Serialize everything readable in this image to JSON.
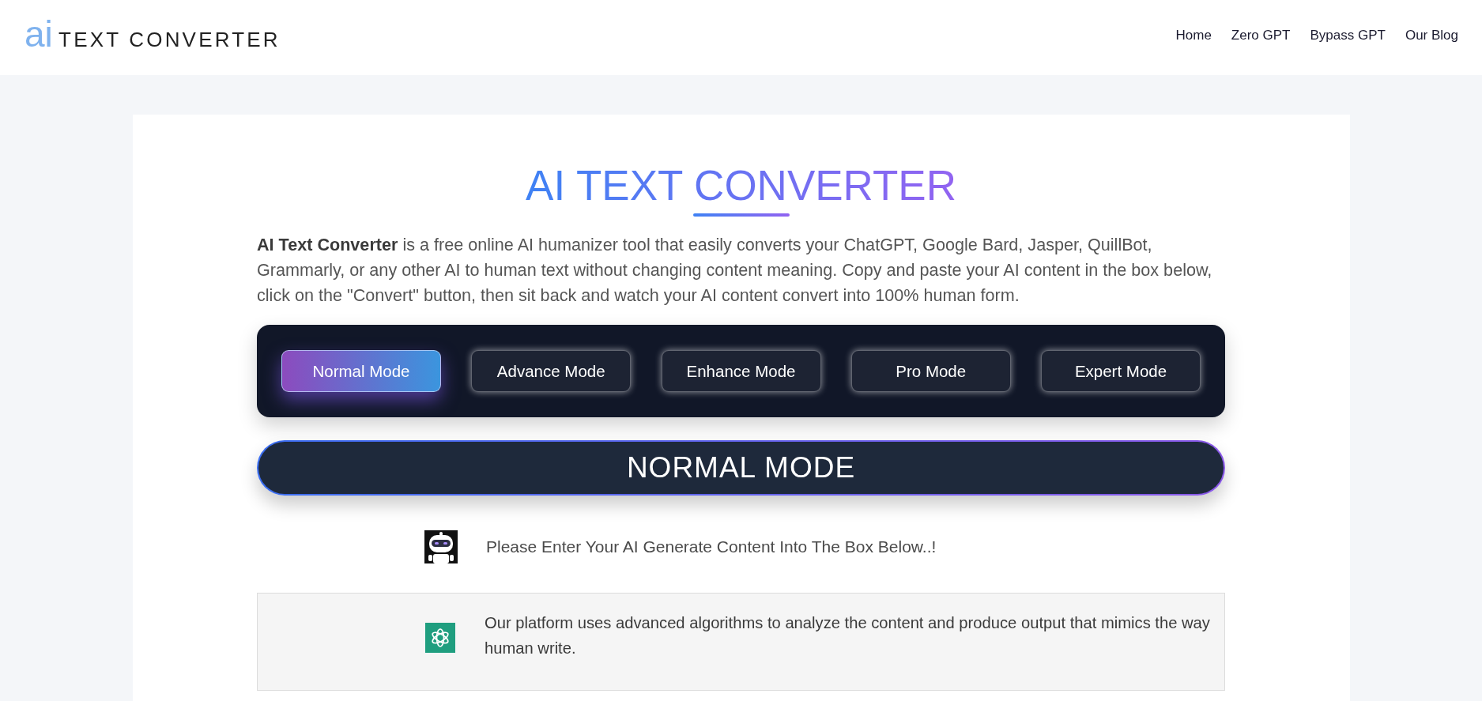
{
  "header": {
    "logo": {
      "mark": "ai",
      "text": "TEXT CONVERTER"
    },
    "nav": [
      {
        "label": "Home"
      },
      {
        "label": "Zero GPT"
      },
      {
        "label": "Bypass GPT"
      },
      {
        "label": "Our Blog"
      }
    ]
  },
  "hero": {
    "title": "AI TEXT CONVERTER",
    "intro": "**AI Text Converter** is a free online AI humanizer tool that easily converts your ChatGPT, Google Bard, Jasper, QuillBot, Grammarly, or any other AI to human text without changing content meaning. Copy and paste your AI content in the box below, click on the \"Convert\" button, then sit back and watch your AI content convert into 100% human form."
  },
  "modes": [
    {
      "label": "Normal Mode",
      "selected": true
    },
    {
      "label": "Advance Mode",
      "selected": false
    },
    {
      "label": "Enhance Mode",
      "selected": false
    },
    {
      "label": "Pro Mode",
      "selected": false
    },
    {
      "label": "Expert Mode",
      "selected": false
    }
  ],
  "mode_banner": {
    "label": "NORMAL MODE"
  },
  "prompt": {
    "text": "Please Enter Your AI Generate Content Into The Box Below..!"
  },
  "info_box": {
    "text": "Our platform uses advanced algorithms to analyze the content and produce output that mimics the way human write."
  }
}
